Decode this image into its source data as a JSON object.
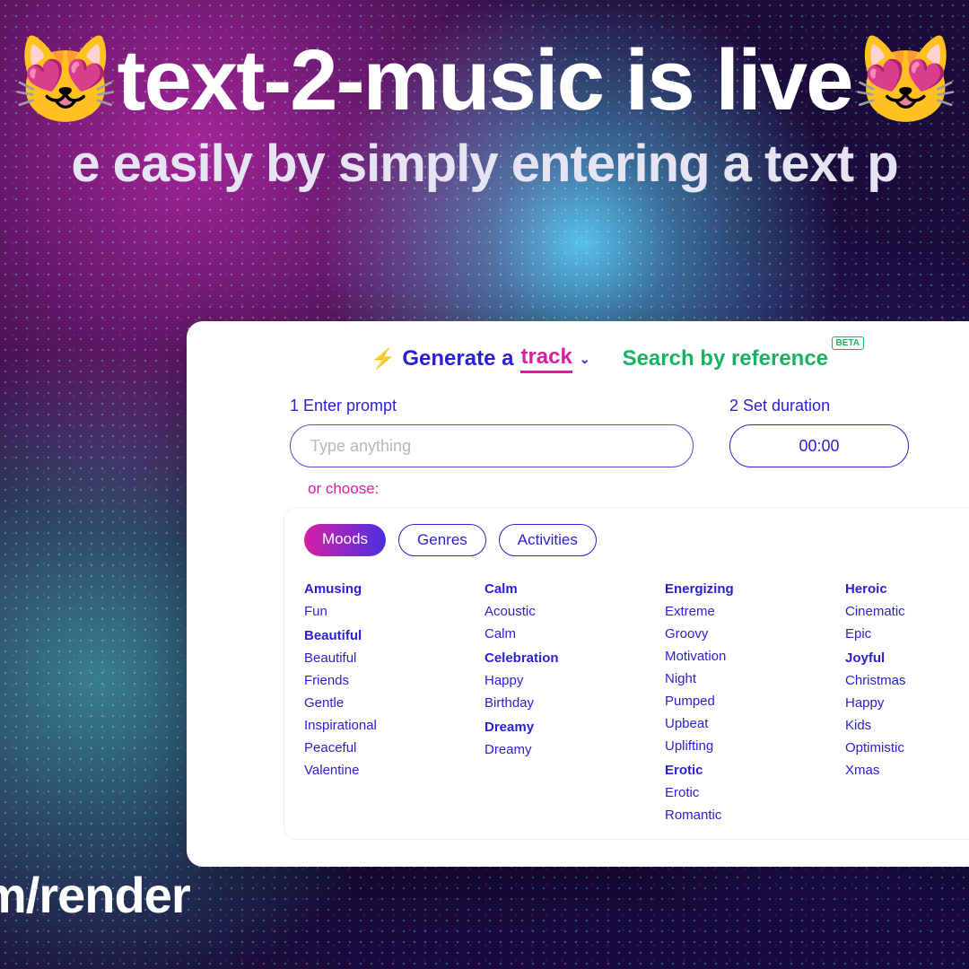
{
  "hero": {
    "emoji": "😻",
    "title": "text-2-music is live",
    "subtitle": "e easily by simply entering a text p"
  },
  "tabs": {
    "generate_prefix": "Generate a",
    "generate_word": "track",
    "search_ref": "Search by reference",
    "beta": "BETA"
  },
  "steps": {
    "prompt_label": "1 Enter prompt",
    "prompt_placeholder": "Type anything",
    "duration_label": "2 Set duration",
    "duration_value": "00:00",
    "or_choose": "or choose:"
  },
  "filters": {
    "moods": "Moods",
    "genres": "Genres",
    "activities": "Activities"
  },
  "mood_cols": [
    [
      {
        "title": "Amusing",
        "items": [
          "Fun"
        ]
      },
      {
        "title": "Beautiful",
        "items": [
          "Beautiful",
          "Friends",
          "Gentle",
          "Inspirational",
          "Peaceful",
          "Valentine"
        ]
      }
    ],
    [
      {
        "title": "Calm",
        "items": [
          "Acoustic",
          "Calm"
        ]
      },
      {
        "title": "Celebration",
        "items": [
          "Happy",
          "Birthday"
        ]
      },
      {
        "title": "Dreamy",
        "items": [
          "Dreamy"
        ]
      }
    ],
    [
      {
        "title": "Energizing",
        "items": [
          "Extreme",
          "Groovy",
          "Motivation",
          "Night",
          "Pumped",
          "Upbeat",
          "Uplifting"
        ]
      },
      {
        "title": "Erotic",
        "items": [
          "Erotic",
          "Romantic"
        ]
      }
    ],
    [
      {
        "title": "Heroic",
        "items": [
          "Cinematic",
          "Epic"
        ]
      },
      {
        "title": "Joyful",
        "items": [
          "Christmas",
          "Happy",
          "Kids",
          "Optimistic",
          "Xmas"
        ]
      }
    ]
  ],
  "footer": "m/render"
}
